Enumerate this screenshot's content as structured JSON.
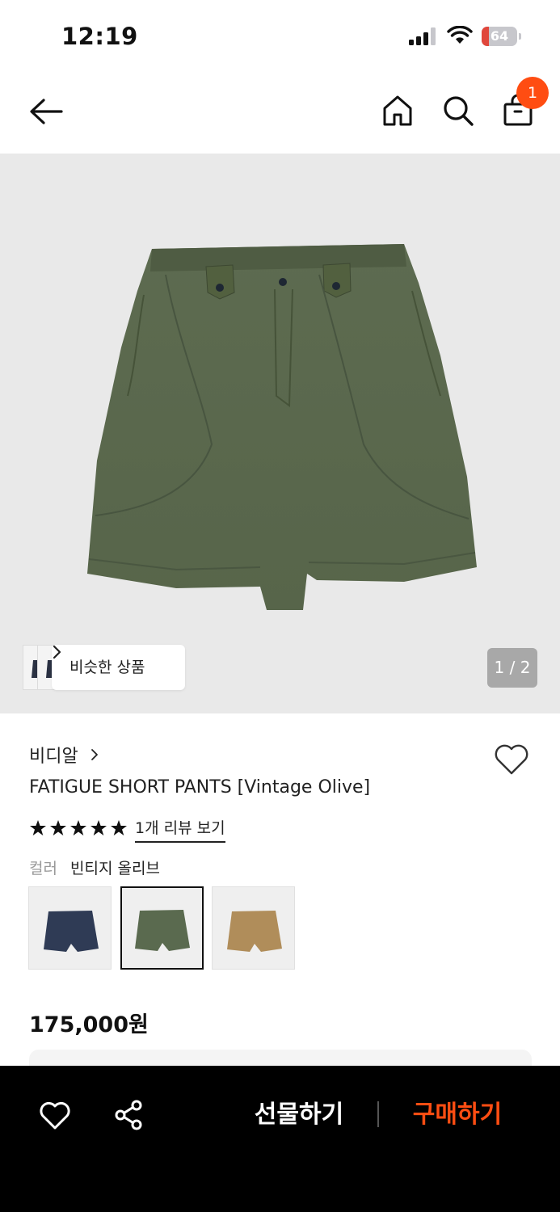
{
  "status_bar": {
    "time": "12:19",
    "battery_level": "64"
  },
  "header": {
    "cart_count": "1"
  },
  "gallery": {
    "similar_label": "비슷한 상품",
    "page_indicator": "1 / 2",
    "background_color": "#e9e9e9"
  },
  "product": {
    "brand": "비디알",
    "title": "FATIGUE SHORT PANTS [Vintage Olive]",
    "rating_stars": 5,
    "review_link": "1개 리뷰 보기",
    "color_label": "컬러",
    "color_value": "빈티지 올리브",
    "swatches": [
      {
        "name": "navy",
        "color": "#2f3b55",
        "selected": false
      },
      {
        "name": "olive",
        "color": "#5a6a4f",
        "selected": true
      },
      {
        "name": "khaki",
        "color": "#b08d5a",
        "selected": false
      }
    ],
    "price": "175,000원"
  },
  "bottom_bar": {
    "gift_label": "선물하기",
    "buy_label": "구매하기",
    "accent_color": "#ff4d12"
  }
}
